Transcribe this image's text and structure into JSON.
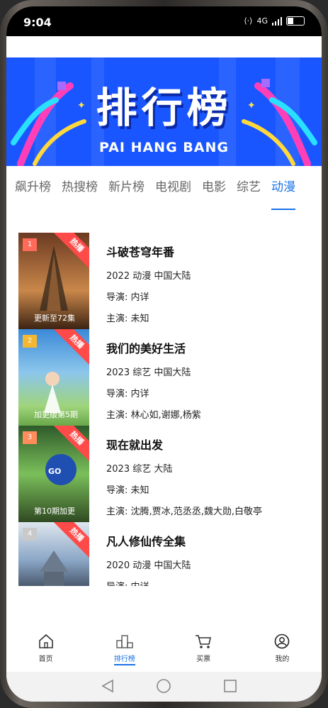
{
  "status": {
    "time": "9:04",
    "network": "4G"
  },
  "banner": {
    "title": "排行榜",
    "subtitle": "PAI HANG BANG",
    "bg_color": "#1a56ff"
  },
  "tabs": [
    "飙升榜",
    "热搜榜",
    "新片榜",
    "电视剧",
    "电影",
    "综艺",
    "动漫"
  ],
  "active_tab": "动漫",
  "list": [
    {
      "rank": "1",
      "badge": "热播",
      "title": "斗破苍穹年番",
      "meta": "2022 动漫 中国大陆",
      "director": "导演: 内详",
      "cast": "主演: 未知",
      "poster_caption": "更新至72集",
      "poster_colors": [
        "#6b3a22",
        "#c9874a"
      ],
      "rank_color": "#ff6a5a"
    },
    {
      "rank": "2",
      "badge": "热播",
      "title": "我们的美好生活",
      "meta": "2023 综艺 中国大陆",
      "director": "导演: 内详",
      "cast": "主演: 林心如,谢娜,杨紫",
      "poster_caption": "加更版第5期",
      "poster_colors": [
        "#5aa6e0",
        "#9fd47a"
      ],
      "rank_color": "#f5b731"
    },
    {
      "rank": "3",
      "badge": "热播",
      "title": "现在就出发",
      "meta": "2023 综艺 大陆",
      "director": "导演: 未知",
      "cast": "主演: 沈腾,贾冰,范丞丞,魏大勋,白敬亭",
      "poster_caption": "第10期加更",
      "poster_colors": [
        "#2e5a2a",
        "#7bbf5a"
      ],
      "rank_color": "#ff8c5a"
    },
    {
      "rank": "4",
      "badge": "热播",
      "title": "凡人修仙传全集",
      "meta": "2020 动漫 中国大陆",
      "director": "导演: 内详",
      "cast": "",
      "poster_caption": "",
      "poster_colors": [
        "#8aa6c6",
        "#d8dde6"
      ],
      "rank_color": "#c9c9c9"
    }
  ],
  "bottom_nav": [
    {
      "label": "首页",
      "icon": "home-icon"
    },
    {
      "label": "排行榜",
      "icon": "ranking-icon"
    },
    {
      "label": "买票",
      "icon": "cart-icon"
    },
    {
      "label": "我的",
      "icon": "user-icon"
    }
  ],
  "active_nav": "排行榜"
}
